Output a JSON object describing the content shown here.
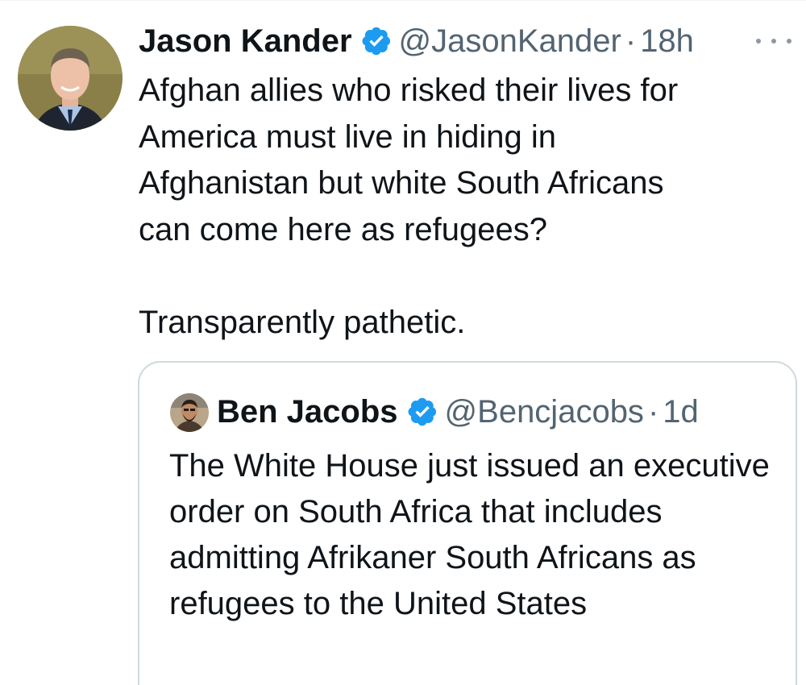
{
  "tweet": {
    "author": {
      "display_name": "Jason Kander",
      "handle": "@JasonKander",
      "verified": true
    },
    "separator": "·",
    "time": "18h",
    "text": "Afghan allies who risked their lives for\nAmerica must live in hiding in\nAfghanistan but white South Africans\ncan come here as refugees?\n\nTransparently pathetic.",
    "more_icon": "more-horizontal-icon"
  },
  "quoted_tweet": {
    "author": {
      "display_name": "Ben Jacobs",
      "handle": "@Bencjacobs",
      "verified": true
    },
    "separator": "·",
    "time": "1d",
    "text": "The White House just issued an executive order on South Africa that includes admitting Afrikaner South Africans as refugees to the United States"
  },
  "colors": {
    "text": "#0f1419",
    "secondary_text": "#536471",
    "verified_badge": "#1d9bf0",
    "border": "#cfd9de"
  }
}
